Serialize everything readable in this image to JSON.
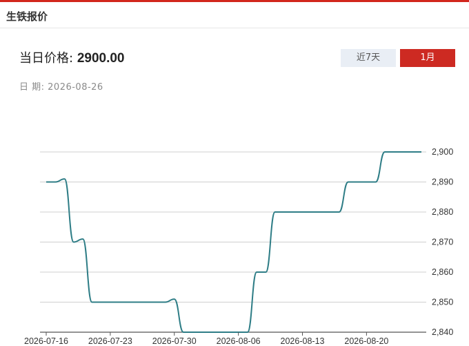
{
  "header": {
    "title": "生铁报价"
  },
  "price": {
    "label": "当日价格:",
    "value": "2900.00"
  },
  "date": {
    "label": "日 期:",
    "value": "2026-08-26"
  },
  "tabs": [
    {
      "label": "近7天",
      "active": false
    },
    {
      "label": "1月",
      "active": true
    }
  ],
  "colors": {
    "accent": "#cd2a22",
    "line": "#2e7d86",
    "tab_inactive": "#e9eef5"
  },
  "chart_data": {
    "type": "line",
    "x": [
      "2026-07-16",
      "2026-07-17",
      "2026-07-18",
      "2026-07-19",
      "2026-07-20",
      "2026-07-21",
      "2026-07-22",
      "2026-07-23",
      "2026-07-24",
      "2026-07-25",
      "2026-07-26",
      "2026-07-27",
      "2026-07-28",
      "2026-07-29",
      "2026-07-30",
      "2026-07-31",
      "2026-08-01",
      "2026-08-02",
      "2026-08-03",
      "2026-08-04",
      "2026-08-05",
      "2026-08-06",
      "2026-08-07",
      "2026-08-08",
      "2026-08-09",
      "2026-08-10",
      "2026-08-11",
      "2026-08-12",
      "2026-08-13",
      "2026-08-14",
      "2026-08-15",
      "2026-08-16",
      "2026-08-17",
      "2026-08-18",
      "2026-08-19",
      "2026-08-20",
      "2026-08-21",
      "2026-08-22",
      "2026-08-23",
      "2026-08-24",
      "2026-08-25",
      "2026-08-26"
    ],
    "series": [
      {
        "values": [
          2890,
          2890,
          2891,
          2870,
          2871,
          2850,
          2850,
          2850,
          2850,
          2850,
          2850,
          2850,
          2850,
          2850,
          2851,
          2840,
          2840,
          2840,
          2840,
          2840,
          2840,
          2840,
          2840,
          2860,
          2860,
          2880,
          2880,
          2880,
          2880,
          2880,
          2880,
          2880,
          2880,
          2890,
          2890,
          2890,
          2890,
          2900,
          2900,
          2900,
          2900,
          2900
        ]
      }
    ],
    "xticks": [
      "2026-07-16",
      "2026-07-23",
      "2026-07-30",
      "2026-08-06",
      "2026-08-13",
      "2026-08-20"
    ],
    "yticks": [
      2840,
      2850,
      2860,
      2870,
      2880,
      2890,
      2900
    ],
    "ytick_labels": [
      "2,840",
      "2,850",
      "2,860",
      "2,870",
      "2,880",
      "2,890",
      "2,900"
    ],
    "ylim": [
      2840,
      2900
    ],
    "grid": true,
    "yaxis_side": "right"
  }
}
